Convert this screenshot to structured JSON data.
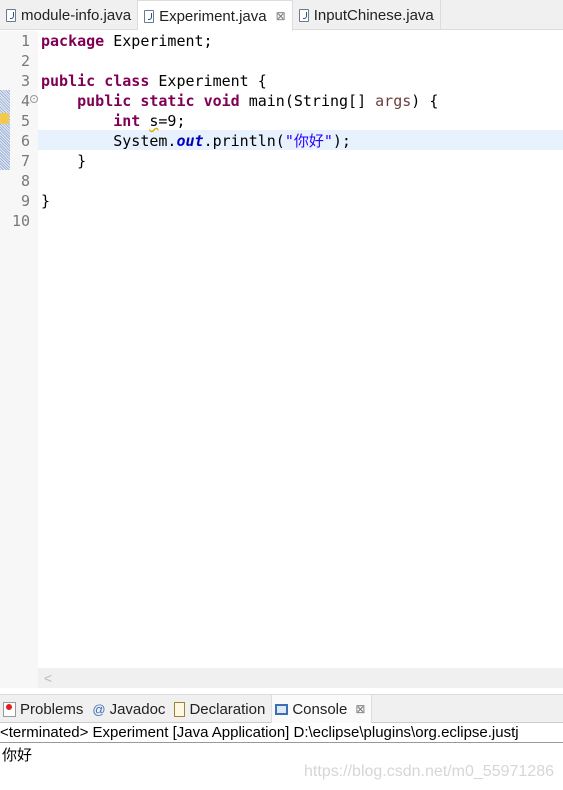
{
  "editor_tabs": [
    {
      "label": "module-info.java",
      "icon": "java-file-icon"
    },
    {
      "label": "Experiment.java",
      "icon": "java-file-warning-icon",
      "active": true,
      "close": "⊠"
    },
    {
      "label": "InputChinese.java",
      "icon": "java-file-icon"
    }
  ],
  "line_numbers": [
    "1",
    "2",
    "3",
    "4",
    "5",
    "6",
    "7",
    "8",
    "9",
    "10"
  ],
  "code": {
    "l1": {
      "kw": "package",
      "rest": " Experiment;"
    },
    "l3": {
      "kw1": "public",
      "kw2": "class",
      "rest": " Experiment {"
    },
    "l4": {
      "kw1": "public",
      "kw2": "static",
      "kw3": "void",
      "a": " main(String[] ",
      "param": "args",
      "b": ") {"
    },
    "l5": {
      "kw": "int",
      "var": "s",
      "rest": "=9;"
    },
    "l6": {
      "a": "System.",
      "field": "out",
      "b": ".println(",
      "str": "\"你好\"",
      "c": ");"
    },
    "l7": "}",
    "l9": "}"
  },
  "scroll_left": "<",
  "panel_tabs": [
    {
      "label": "Problems",
      "icon": "problems-icon"
    },
    {
      "label": "Javadoc",
      "icon": "@"
    },
    {
      "label": "Declaration",
      "icon": "declaration-icon"
    },
    {
      "label": "Console",
      "icon": "console-icon",
      "active": true,
      "close": "⊠"
    }
  ],
  "console": {
    "header": "<terminated> Experiment [Java Application] D:\\eclipse\\plugins\\org.eclipse.justj",
    "output": "你好"
  },
  "watermark": "https://blog.csdn.net/m0_55971286",
  "colors": {
    "keyword": "#7f0055",
    "string": "#2a00ff",
    "current_line": "#e8f2fe"
  }
}
